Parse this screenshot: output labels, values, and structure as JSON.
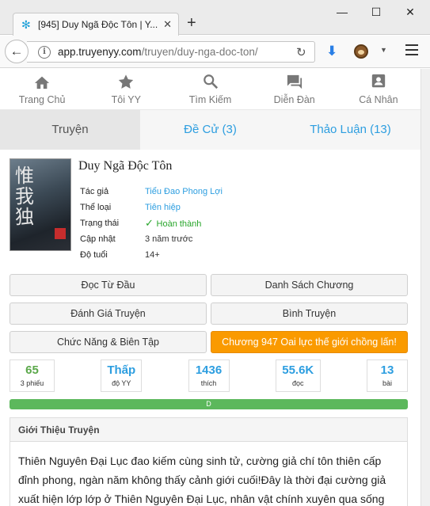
{
  "browser": {
    "tab_title": "[945] Duy Ngã Độc Tôn | Y...",
    "url_host": "app.truyenyy.com",
    "url_path": "/truyen/duy-nga-doc-ton/"
  },
  "topnav": [
    {
      "label": "Trang Chủ",
      "icon": "home-icon"
    },
    {
      "label": "Tôi YY",
      "icon": "star-icon"
    },
    {
      "label": "Tìm Kiếm",
      "icon": "search-icon"
    },
    {
      "label": "Diễn Đàn",
      "icon": "forum-icon"
    },
    {
      "label": "Cá Nhân",
      "icon": "account-icon"
    }
  ],
  "subtabs": [
    {
      "label": "Truyện",
      "active": true
    },
    {
      "label": "Đề Cử (3)",
      "active": false
    },
    {
      "label": "Thảo Luận (13)",
      "active": false
    }
  ],
  "book": {
    "title": "Duy Ngã Độc Tôn",
    "meta": [
      {
        "label": "Tác giả",
        "value": "Tiểu Đao Phong Lợi"
      },
      {
        "label": "Thể loại",
        "value": "Tiên hiệp"
      },
      {
        "label": "Trạng thái",
        "value": "Hoàn thành"
      },
      {
        "label": "Cập nhật",
        "value": "3 năm trước"
      },
      {
        "label": "Độ tuổi",
        "value": "14+"
      }
    ]
  },
  "actions": {
    "read_from_start": "Đọc Từ Đầu",
    "chapter_list": "Danh Sách Chương",
    "rate_story": "Đánh Giá Truyện",
    "review_story": "Bình Truyện",
    "functions_edit": "Chức Năng & Biên Tập",
    "latest_chapter": "Chương 947 Oai lực thế giới chồng lấn!"
  },
  "stats": [
    {
      "value": "65",
      "label": "3 phiếu",
      "color": "#5ba84a"
    },
    {
      "value": "Thấp",
      "label": "độ YY",
      "color": "#2d9ee0"
    },
    {
      "value": "1436",
      "label": "thích",
      "color": "#2d9ee0"
    },
    {
      "value": "55.6K",
      "label": "đọc",
      "color": "#2d9ee0"
    },
    {
      "value": "13",
      "label": "bài",
      "color": "#2d9ee0"
    }
  ],
  "progress": {
    "label": "D",
    "fraction": 1.0
  },
  "intro": {
    "heading": "Giới Thiệu Truyện",
    "text": "Thiên Nguyên Đại Lục đao kiếm cùng sinh tử, cường giả chí tôn thiên cấp đỉnh phong, ngàn năm không thấy cảnh giới cuối!Đây là thời đại cường giả xuất hiện lớp lớp ở Thiên Nguyên Đại Lục, nhân vật chính xuyên qua sống"
  },
  "colors": {
    "accent": "#2d9ee0",
    "orange": "#fa9a00",
    "green": "#5cb85c"
  }
}
